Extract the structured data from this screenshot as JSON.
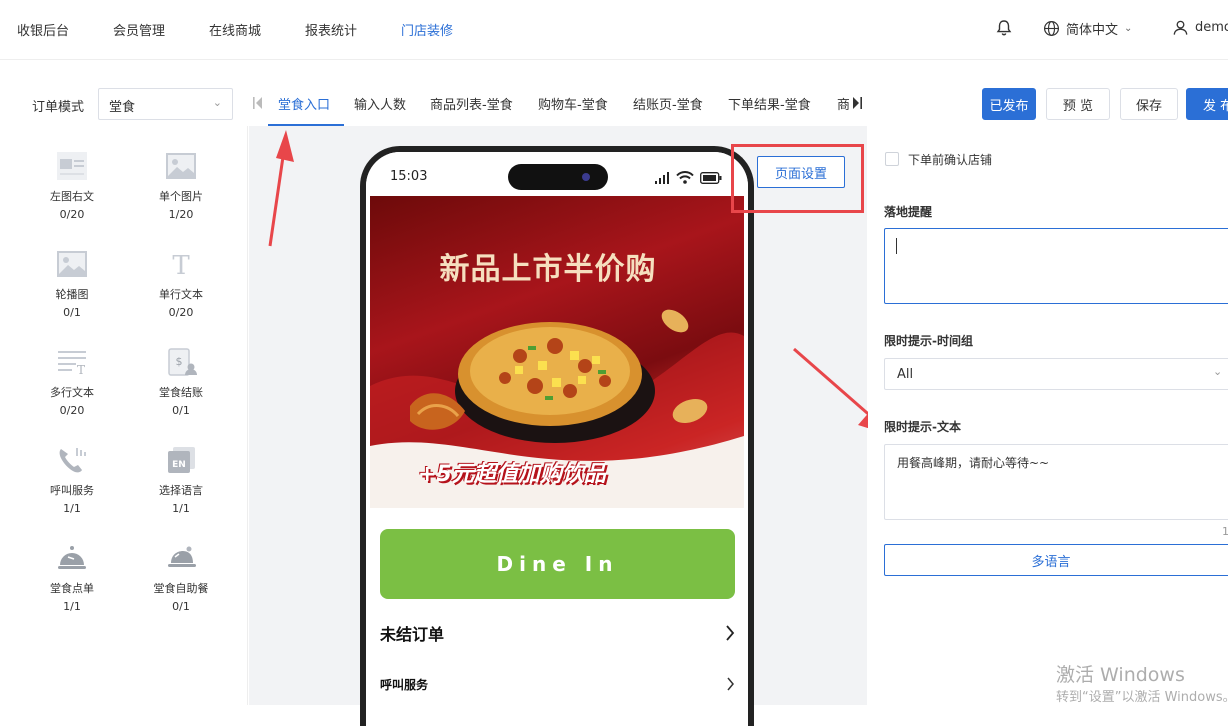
{
  "topnav": {
    "items": [
      "收银后台",
      "会员管理",
      "在线商城",
      "报表统计",
      "门店装修"
    ],
    "active_index": 4,
    "language": "简体中文",
    "user": "demo"
  },
  "toolbar": {
    "order_mode_label": "订单模式",
    "order_mode_value": "堂食",
    "tabs": [
      "堂食入口",
      "输入人数",
      "商品列表-堂食",
      "购物车-堂食",
      "结账页-堂食",
      "下单结果-堂食",
      "商"
    ],
    "active_tab": 0,
    "published_label": "已发布",
    "preview_label": "预 览",
    "save_label": "保存",
    "publish_label": "发 布"
  },
  "components": [
    {
      "name": "左图右文",
      "count": "0/20",
      "icon": "image-text-icon"
    },
    {
      "name": "单个图片",
      "count": "1/20",
      "icon": "image-icon"
    },
    {
      "name": "轮播图",
      "count": "0/1",
      "icon": "carousel-icon"
    },
    {
      "name": "单行文本",
      "count": "0/20",
      "icon": "text-icon"
    },
    {
      "name": "多行文本",
      "count": "0/20",
      "icon": "multiline-text-icon"
    },
    {
      "name": "堂食结账",
      "count": "0/1",
      "icon": "checkout-icon"
    },
    {
      "name": "呼叫服务",
      "count": "1/1",
      "icon": "phone-icon"
    },
    {
      "name": "选择语言",
      "count": "1/1",
      "icon": "language-icon"
    },
    {
      "name": "堂食点单",
      "count": "1/1",
      "icon": "cloche-icon"
    },
    {
      "name": "堂食自助餐",
      "count": "0/1",
      "icon": "buffet-icon"
    }
  ],
  "phone": {
    "time": "15:03",
    "page_settings_label": "页面设置",
    "banner_title": "新品上市半价购",
    "banner_promo": "+5元超值加购饮品",
    "dine_in_label": "Dine In",
    "unpaid_orders_label": "未结订单",
    "call_service_label": "呼叫服务"
  },
  "settings": {
    "confirm_store_label": "下单前确认店铺",
    "landing_reminder_label": "落地提醒",
    "landing_reminder_value": "",
    "time_group_label": "限时提示-时间组",
    "time_group_value": "All",
    "tip_text_label": "限时提示-文本",
    "tip_text_value": "用餐高峰期，请耐心等待~~",
    "tip_text_count": "1",
    "multilang_label": "多语言"
  },
  "watermark": {
    "line1": "激活 Windows",
    "line2": "转到“设置”以激活 Windows。"
  },
  "colors": {
    "accent": "#2b6fd6",
    "dine_in": "#7bbf44",
    "annotation": "#e8464a"
  }
}
